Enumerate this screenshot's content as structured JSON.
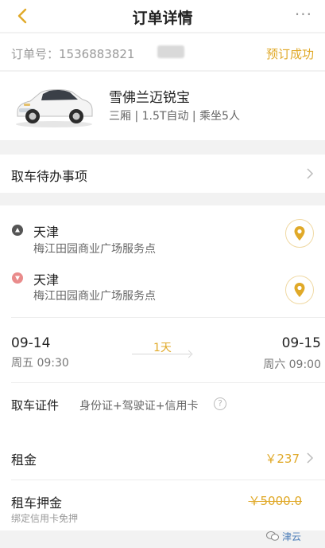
{
  "header": {
    "title": "订单详情",
    "more": "···"
  },
  "order": {
    "label": "订单号：",
    "number": "1536883821",
    "status": "预订成功"
  },
  "car": {
    "name": "雪佛兰迈锐宝",
    "spec": "三厢 | 1.5T自动 | 乘坐5人"
  },
  "todo": {
    "label": "取车待办事项"
  },
  "pickup": {
    "city": "天津",
    "address": "梅江田园商业广场服务点"
  },
  "return": {
    "city": "天津",
    "address": "梅江田园商业广场服务点"
  },
  "rental": {
    "start_date": "09-14",
    "start_time": "周五 09:30",
    "duration": "1天",
    "end_date": "09-15",
    "end_time": "周六 09:00"
  },
  "documents": {
    "label": "取车证件",
    "value": "身份证+驾驶证+信用卡",
    "help": "?"
  },
  "fees": {
    "rent_label": "租金",
    "rent_value": "￥237",
    "deposit_label": "租车押金",
    "deposit_value": "￥5000.0",
    "deposit_note": "绑定信用卡免押"
  },
  "watermark": {
    "text": "津云"
  },
  "colors": {
    "accent": "#e0a928",
    "pickup_dot": "#555555",
    "return_dot": "#e98b8b"
  }
}
